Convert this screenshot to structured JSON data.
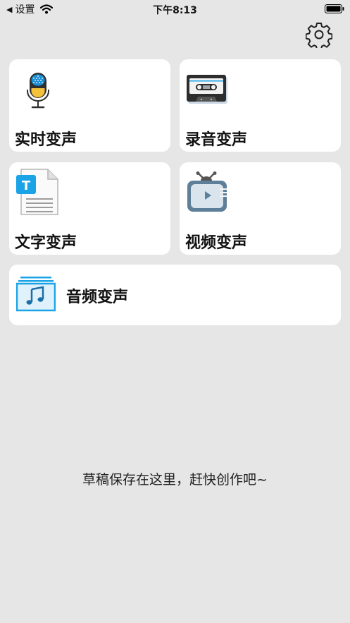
{
  "status_bar": {
    "back_label": "设置",
    "time": "下午8:13"
  },
  "cards": {
    "realtime": {
      "label": "实时变声",
      "icon": "microphone-icon"
    },
    "recording": {
      "label": "录音变声",
      "icon": "cassette-icon"
    },
    "text": {
      "label": "文字变声",
      "icon": "text-document-icon",
      "badge": "T"
    },
    "video": {
      "label": "视频变声",
      "icon": "tv-icon"
    },
    "audio": {
      "label": "音频变声",
      "icon": "music-file-icon"
    }
  },
  "empty_hint": "草稿保存在这里，赶快创作吧~",
  "colors": {
    "background": "#e6e6e6",
    "card": "#ffffff",
    "accent_blue": "#1aa3e6",
    "mic_yellow": "#f3c13a"
  }
}
